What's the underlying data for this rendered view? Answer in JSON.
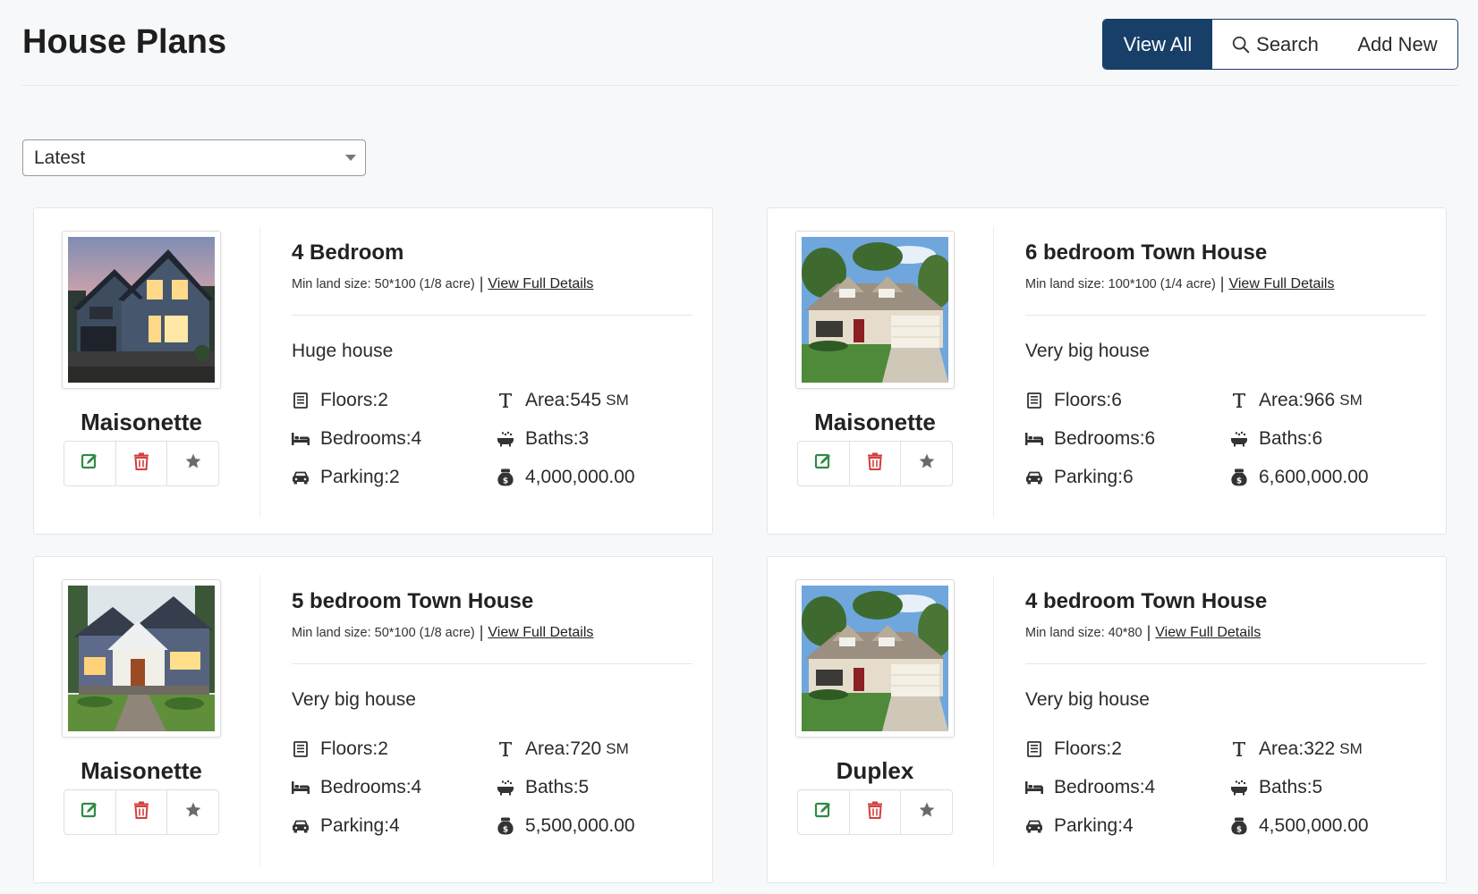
{
  "header": {
    "title": "House Plans",
    "view_all_label": "View All",
    "search_label": "Search",
    "add_new_label": "Add New"
  },
  "sort": {
    "selected": "Latest"
  },
  "labels": {
    "view_details": "View Full Details",
    "floors": "Floors: ",
    "bedrooms": "Bedrooms: ",
    "parking": "Parking: ",
    "area": "Area: ",
    "baths": "Baths: ",
    "area_unit": "SM",
    "separator": "|"
  },
  "colors": {
    "primary": "#173f68",
    "edit_green": "#2e8b45",
    "delete_red": "#d23f3f",
    "star_gray": "#6b6b6b"
  },
  "plans": [
    {
      "type": "Maisonette",
      "title": "4 Bedroom",
      "min_land": "Min land size: 50*100 (1/8 acre)",
      "description": "Huge house",
      "floors": "2",
      "bedrooms": "4",
      "parking": "2",
      "area": "545",
      "baths": "3",
      "price": "4,000,000.00",
      "image": "modern-farmhouse-photo"
    },
    {
      "type": "Maisonette",
      "title": "6 bedroom Town House",
      "min_land": "Min land size: 100*100 (1/4 acre)",
      "description": "Very big house",
      "floors": "6",
      "bedrooms": "6",
      "parking": "6",
      "area": "966",
      "baths": "6",
      "price": "6,600,000.00",
      "image": "ranch-house-photo"
    },
    {
      "type": "Maisonette",
      "title": "5 bedroom Town House",
      "min_land": "Min land size: 50*100 (1/8 acre)",
      "description": "Very big house",
      "floors": "2",
      "bedrooms": "4",
      "parking": "4",
      "area": "720",
      "baths": "5",
      "price": "5,500,000.00",
      "image": "craftsman-house-photo"
    },
    {
      "type": "Duplex",
      "title": "4 bedroom Town House",
      "min_land": "Min land size: 40*80",
      "description": "Very big house",
      "floors": "2",
      "bedrooms": "4",
      "parking": "4",
      "area": "322",
      "baths": "5",
      "price": "4,500,000.00",
      "image": "ranch-house-photo"
    }
  ]
}
